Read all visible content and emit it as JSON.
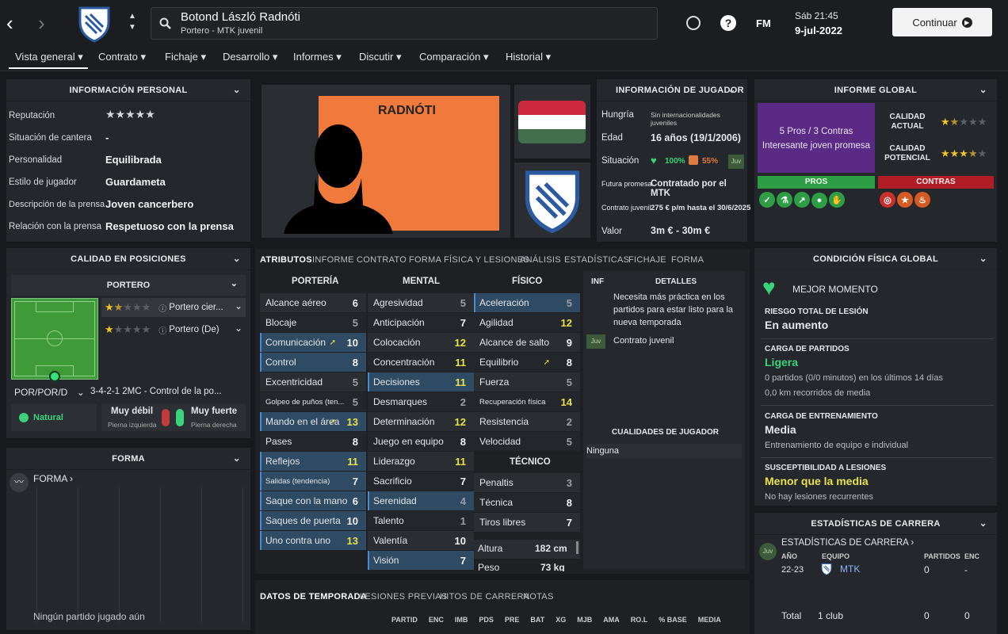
{
  "header": {
    "player_name": "Botond László Radnóti",
    "subtitle": "Portero - MTK juvenil",
    "time": "Sáb 21:45",
    "date": "9-jul-2022",
    "continue_label": "Continuar",
    "fm_label": "FM"
  },
  "nav": {
    "tabs": [
      "Vista general",
      "Contrato",
      "Fichaje",
      "Desarrollo",
      "Informes",
      "Discutir",
      "Comparación",
      "Historial"
    ]
  },
  "personal": {
    "title": "INFORMACIÓN PERSONAL",
    "rows": [
      {
        "label": "Reputación",
        "value": ""
      },
      {
        "label": "Situación de cantera",
        "value": "-"
      },
      {
        "label": "Personalidad",
        "value": "Equilibrada"
      },
      {
        "label": "Estilo de jugador",
        "value": "Guardameta"
      },
      {
        "label": "Descripción de la prensa",
        "value": "Joven cancerbero"
      },
      {
        "label": "Relación con la prensa",
        "value": "Respetuoso con la prensa"
      }
    ],
    "reputation_stars": 0
  },
  "positions": {
    "title": "CALIDAD EN POSICIONES",
    "dropdown": "PORTERO",
    "roles": [
      {
        "name": "Portero cier...",
        "stars": 1.5
      },
      {
        "name": "Portero (De)",
        "stars": 1
      }
    ],
    "position_select": "POR/POR/D",
    "tactic_select": "3-4-2-1 2MC - Control de la po...",
    "natural_label": "Natural",
    "weak_foot_label": "Muy débil",
    "weak_foot_sub": "Pierna izquierda",
    "strong_foot_label": "Muy fuerte",
    "strong_foot_sub": "Pierna derecha"
  },
  "form": {
    "title": "FORMA",
    "link": "FORMA",
    "empty": "Ningún partido jugado aún"
  },
  "kit": {
    "shirt_name": "RADNÓTI"
  },
  "player_info": {
    "title": "INFORMACIÓN DE JUGADOR",
    "nation": "Hungría",
    "caps": "Sin internacionalidades juveniles",
    "age_label": "Edad",
    "age_value": "16 años (19/1/2006)",
    "situation_label": "Situación",
    "fitness": "100%",
    "sharpness": "55%",
    "juv_badge": "Juv",
    "future_label": "Futura promesa",
    "future_value": "Contratado por el MTK",
    "contract_label": "Contrato juvenil",
    "contract_value": "275 € p/m hasta el 30/6/2025",
    "value_label": "Valor",
    "value_value": "3m € - 30m €"
  },
  "global_report": {
    "title": "INFORME GLOBAL",
    "pros_cons": "5 Pros / 3 Contras",
    "summary": "Interesante joven promesa",
    "current_label_1": "CALIDAD",
    "current_label_2": "ACTUAL",
    "potential_label_1": "CALIDAD",
    "potential_label_2": "POTENCIAL",
    "current_stars": 1.5,
    "potential_stars": 3.5,
    "pros_label": "PROS",
    "cons_label": "CONTRAS"
  },
  "attr_tabs": [
    "ATRIBUTOS",
    "INFORME",
    "CONTRATO",
    "FORMA FÍSICA Y LESIONES",
    "ANÁLISIS",
    "ESTADÍSTICAS",
    "FICHAJE",
    "FORMA"
  ],
  "attributes": {
    "goalkeeping_title": "PORTERÍA",
    "mental_title": "MENTAL",
    "physical_title": "FÍSICO",
    "technical_title": "TÉCNICO",
    "goalkeeping": [
      {
        "name": "Alcance aéreo",
        "value": "6"
      },
      {
        "name": "Blocaje",
        "value": "5"
      },
      {
        "name": "Comunicación",
        "value": "10"
      },
      {
        "name": "Control",
        "value": "8"
      },
      {
        "name": "Excentricidad",
        "value": "5"
      },
      {
        "name": "Golpeo de puños (ten...",
        "value": "5"
      },
      {
        "name": "Mando en el área",
        "value": "13"
      },
      {
        "name": "Pases",
        "value": "8"
      },
      {
        "name": "Reflejos",
        "value": "11"
      },
      {
        "name": "Salidas (tendencia)",
        "value": "7"
      },
      {
        "name": "Saque con la mano",
        "value": "6"
      },
      {
        "name": "Saques de puerta",
        "value": "10"
      },
      {
        "name": "Uno contra uno",
        "value": "13"
      }
    ],
    "mental": [
      {
        "name": "Agresividad",
        "value": "5"
      },
      {
        "name": "Anticipación",
        "value": "7"
      },
      {
        "name": "Colocación",
        "value": "12"
      },
      {
        "name": "Concentración",
        "value": "11"
      },
      {
        "name": "Decisiones",
        "value": "11"
      },
      {
        "name": "Desmarques",
        "value": "2"
      },
      {
        "name": "Determinación",
        "value": "12"
      },
      {
        "name": "Juego en equipo",
        "value": "8"
      },
      {
        "name": "Liderazgo",
        "value": "11"
      },
      {
        "name": "Sacrificio",
        "value": "7"
      },
      {
        "name": "Serenidad",
        "value": "4"
      },
      {
        "name": "Talento",
        "value": "1"
      },
      {
        "name": "Valentía",
        "value": "10"
      },
      {
        "name": "Visión",
        "value": "7"
      }
    ],
    "physical": [
      {
        "name": "Aceleración",
        "value": "5"
      },
      {
        "name": "Agilidad",
        "value": "12"
      },
      {
        "name": "Alcance de salto",
        "value": "9"
      },
      {
        "name": "Equilibrio",
        "value": "8"
      },
      {
        "name": "Fuerza",
        "value": "5"
      },
      {
        "name": "Recuperación física",
        "value": "14"
      },
      {
        "name": "Resistencia",
        "value": "2"
      },
      {
        "name": "Velocidad",
        "value": "5"
      }
    ],
    "technical": [
      {
        "name": "Penaltis",
        "value": "3"
      },
      {
        "name": "Técnica",
        "value": "8"
      },
      {
        "name": "Tiros libres",
        "value": "7"
      }
    ],
    "height_label": "Altura",
    "height_value": "182 cm",
    "weight_label": "Peso",
    "weight_value": "73 kg"
  },
  "details": {
    "inf_label": "INF",
    "title": "DETALLES",
    "note": "Necesita más práctica en los partidos para estar listo para la nueva temporada",
    "juv": "Juv",
    "contract": "Contrato juvenil",
    "qualities_title": "CUALIDADES DE JUGADOR",
    "qualities_value": "Ninguna"
  },
  "season_tabs": [
    "DATOS DE TEMPORADA",
    "LESIONES PREVIAS",
    "HITOS DE CARRERA",
    "NOTAS"
  ],
  "season_cols": [
    "PARTID",
    "ENC",
    "IMB",
    "PDS",
    "PRE",
    "BAT",
    "XG",
    "MJB",
    "AMA",
    "RO.L",
    "% BASE",
    "MEDIA"
  ],
  "condition": {
    "title": "CONDICIÓN FÍSICA GLOBAL",
    "best": "MEJOR MOMENTO",
    "injury_risk_label": "RIESGO TOTAL DE LESIÓN",
    "injury_risk_value": "En aumento",
    "match_load_label": "CARGA DE PARTIDOS",
    "match_load_value": "Ligera",
    "match_load_note1": "0 partidos (0/0 minutos) en los últimos 14 días",
    "match_load_note2": "0,0 km recorridos de media",
    "training_label": "CARGA DE ENTRENAMIENTO",
    "training_value": "Media",
    "training_note": "Entrenamiento de equipo e individual",
    "susceptibility_label": "SUSCEPTIBILIDAD A LESIONES",
    "susceptibility_value": "Menor que la media",
    "susceptibility_note": "No hay lesiones recurrentes"
  },
  "career": {
    "title": "ESTADÍSTICAS DE CARRERA",
    "link": "ESTADÍSTICAS DE CARRERA",
    "juv": "Juv",
    "col_year": "AÑO",
    "col_team": "EQUIPO",
    "col_matches": "PARTIDOS",
    "col_goals": "ENC",
    "year": "22-23",
    "team": "MTK",
    "matches": "0",
    "goals": "-",
    "total_label": "Total",
    "total_clubs": "1 club",
    "total_matches": "0",
    "total_goals": "0"
  },
  "colors": {
    "accent_green": "#2e9e46",
    "accent_red": "#b11d24",
    "highlight_yellow": "#e7e24a",
    "purple": "#5a2a84",
    "highlight_blue": "#2f4a63"
  }
}
